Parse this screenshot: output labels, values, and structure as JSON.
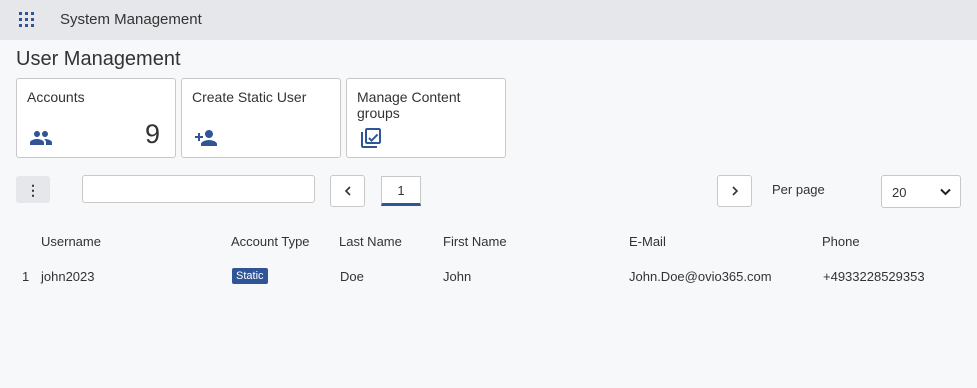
{
  "app": {
    "title": "System Management"
  },
  "page": {
    "title": "User Management"
  },
  "tiles": [
    {
      "label": "Accounts",
      "icon": "people-icon",
      "count": "9"
    },
    {
      "label": "Create Static User",
      "icon": "person-add-icon"
    },
    {
      "label": "Manage Content groups",
      "icon": "checklist-icon"
    }
  ],
  "toolbar": {
    "search_value": "",
    "current_page": "1",
    "per_page_label": "Per page",
    "per_page_value": "20"
  },
  "table": {
    "columns": [
      "Username",
      "Account Type",
      "Last Name",
      "First Name",
      "E-Mail",
      "Phone"
    ],
    "rows": [
      {
        "index": "1",
        "username": "john2023",
        "account_type": "Static",
        "last_name": "Doe",
        "first_name": "John",
        "email": "John.Doe@ovio365.com",
        "phone": "+4933228529353"
      }
    ]
  },
  "colors": {
    "accent": "#2f5597",
    "topbar": "#e6e7ea",
    "background": "#f7f8fa"
  }
}
